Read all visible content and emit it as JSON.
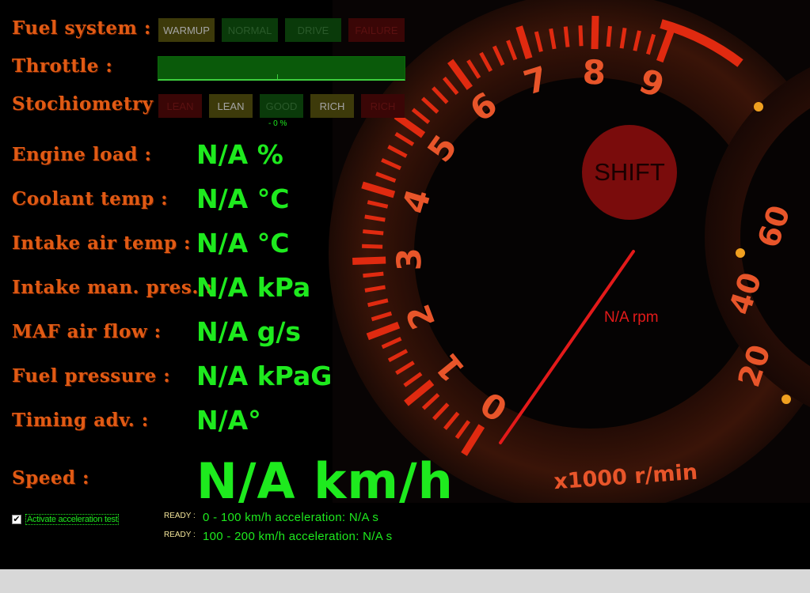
{
  "fuel_system": {
    "label": "Fuel system :",
    "states": [
      {
        "text": "WARMUP",
        "bg": "#3d3a0a",
        "fg": "#a4a4a4"
      },
      {
        "text": "NORMAL",
        "bg": "#0a3a0a",
        "fg": "#2a5a2a"
      },
      {
        "text": "DRIVE",
        "bg": "#0a3a0a",
        "fg": "#2a5a2a"
      },
      {
        "text": "FAILURE",
        "bg": "#3a0606",
        "fg": "#5a1010"
      }
    ]
  },
  "throttle": {
    "label": "Throttle :",
    "level": 0
  },
  "stoichiometry": {
    "label": "Stochiometry :",
    "states": [
      {
        "text": "LEAN",
        "bg": "#3a0606",
        "fg": "#5a1010"
      },
      {
        "text": "LEAN",
        "bg": "#3d3a0a",
        "fg": "#a4a4a4"
      },
      {
        "text": "GOOD",
        "bg": "#0a3a0a",
        "fg": "#2a5a2a"
      },
      {
        "text": "RICH",
        "bg": "#3d3a0a",
        "fg": "#a4a4a4"
      },
      {
        "text": "RICH",
        "bg": "#3a0606",
        "fg": "#5a1010"
      }
    ],
    "percent_text": "- 0 %"
  },
  "readouts": [
    {
      "label": "Engine load :",
      "value": "N/A %"
    },
    {
      "label": "Coolant temp :",
      "value": "N/A °C"
    },
    {
      "label": "Intake air temp :",
      "value": "N/A °C"
    },
    {
      "label": "Intake man. pres. :",
      "value": "N/A kPa"
    },
    {
      "label": "MAF air flow :",
      "value": "N/A g/s"
    },
    {
      "label": "Fuel pressure :",
      "value": "N/A kPaG"
    },
    {
      "label": "Timing adv. :",
      "value": "N/A°"
    }
  ],
  "speed": {
    "label": "Speed :",
    "value": "N/A km/h"
  },
  "acceleration": {
    "checkbox_label": "Activate acceleration test",
    "checked": true,
    "tests": [
      {
        "status": "READY :",
        "text": "0 - 100 km/h acceleration: N/A s"
      },
      {
        "status": "READY :",
        "text": "100 - 200 km/h acceleration: N/A s"
      }
    ]
  },
  "tachometer": {
    "shift_label": "SHIFT",
    "rpm_text": "N/A rpm",
    "unit_text": "x1000 r/min",
    "tick_numbers": [
      "0",
      "1",
      "2",
      "3",
      "4",
      "5",
      "6",
      "7",
      "8",
      "9"
    ],
    "speedo_numbers": [
      "20",
      "40",
      "60"
    ]
  },
  "colors": {
    "label": "#e05a14",
    "value": "#1eea1e",
    "gauge": "#e02a10",
    "needle": "#e31a1a"
  }
}
